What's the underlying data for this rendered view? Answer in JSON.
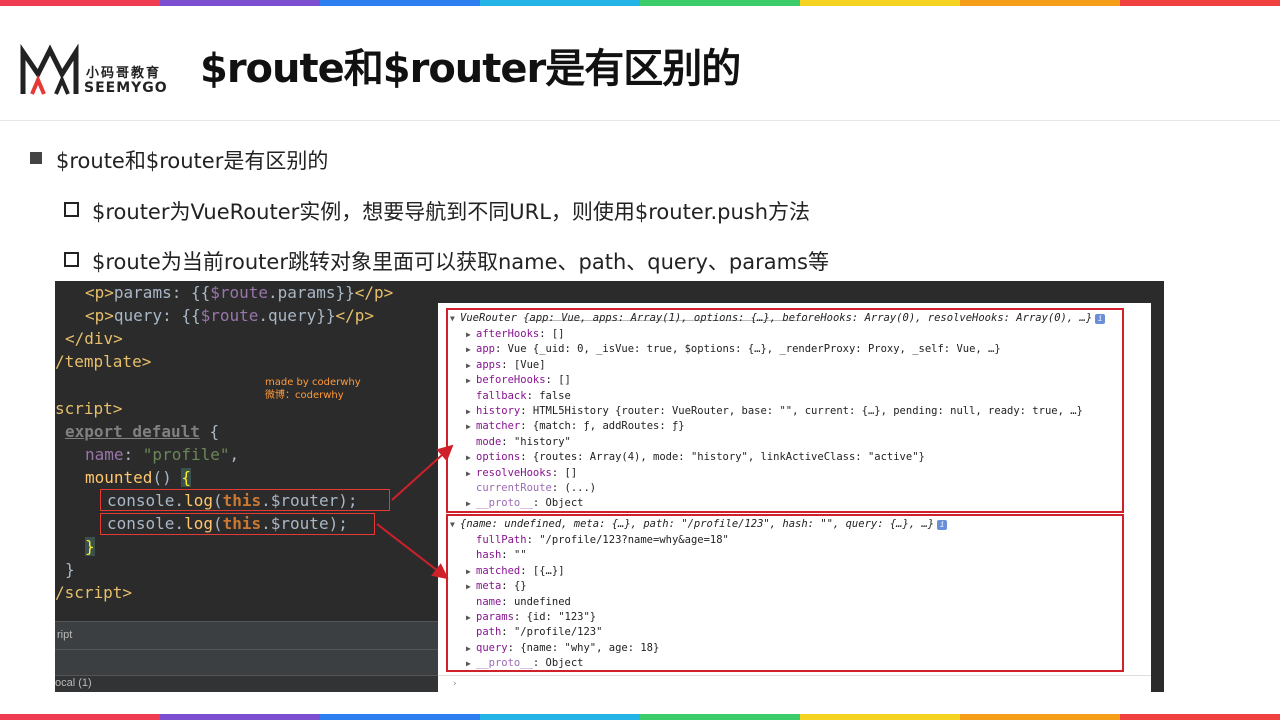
{
  "stripe_colors": [
    "#f03c50",
    "#7b4fd0",
    "#2d7ff0",
    "#25b4e6",
    "#3ccc6a",
    "#f5d320",
    "#f59e1a",
    "#f04040"
  ],
  "logo": {
    "cn": "小码哥教育",
    "en": "SEEMYGO"
  },
  "title": "$route和$router是有区别的",
  "bullets": {
    "level1": "$route和$router是有区别的",
    "level2_a": "$router为VueRouter实例，想要导航到不同URL，则使用$router.push方法",
    "level2_b": "$route为当前router跳转对象里面可以获取name、path、query、params等"
  },
  "editor": {
    "watermark_1": "made by coderwhy",
    "watermark_2": "微博：coderwhy",
    "strip_label": "ript",
    "bottom_label": "ocal (1)"
  },
  "console": {
    "router_header": "VueRouter {app: Vue, apps: Array(1), options: {…}, beforeHooks: Array(0), resolveHooks: Array(0), …}",
    "router_lines": [
      "afterHooks: []",
      "app: Vue {_uid: 0, _isVue: true, $options: {…}, _renderProxy: Proxy, _self: Vue, …}",
      "apps: [Vue]",
      "beforeHooks: []",
      "fallback: false",
      "history: HTML5History {router: VueRouter, base: \"\", current: {…}, pending: null, ready: true, …}",
      "matcher: {match: ƒ, addRoutes: ƒ}",
      "mode: \"history\"",
      "options: {routes: Array(4), mode: \"history\", linkActiveClass: \"active\"}",
      "resolveHooks: []",
      "currentRoute: (...)",
      "__proto__: Object"
    ],
    "route_header": "{name: undefined, meta: {…}, path: \"/profile/123\", hash: \"\", query: {…}, …}",
    "route_lines": [
      "fullPath: \"/profile/123?name=why&age=18\"",
      "hash: \"\"",
      "matched: [{…}]",
      "meta: {}",
      "name: undefined",
      "params: {id: \"123\"}",
      "path: \"/profile/123\"",
      "query: {name: \"why\", age: 18}",
      "__proto__: Object"
    ],
    "info_badge": "i"
  }
}
